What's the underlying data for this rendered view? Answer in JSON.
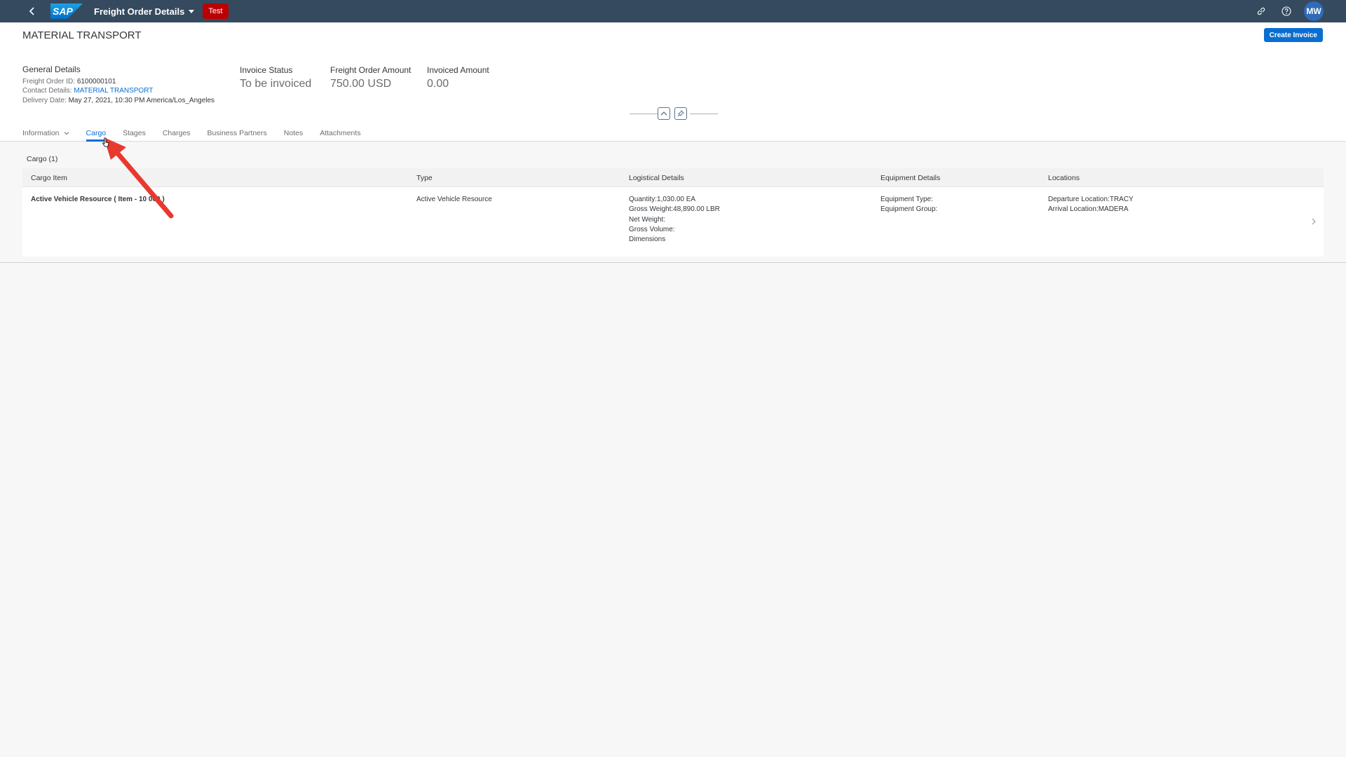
{
  "shell": {
    "logo": "SAP",
    "app_title": "Freight Order Details",
    "env_badge": "Test",
    "avatar_initials": "MW",
    "icons": [
      "back-icon",
      "link-icon",
      "help-icon"
    ]
  },
  "header": {
    "title": "MATERIAL TRANSPORT",
    "create_invoice_label": "Create Invoice",
    "general_details": {
      "title": "General Details",
      "freight_order_id_label": "Freight Order ID:",
      "freight_order_id_value": "6100000101",
      "contact_details_label": "Contact Details:",
      "contact_details_value": "MATERIAL TRANSPORT",
      "delivery_date_label": "Delivery Date:",
      "delivery_date_value": "May 27, 2021, 10:30 PM America/Los_Angeles"
    },
    "kpis": [
      {
        "label": "Invoice Status",
        "value": "To be invoiced"
      },
      {
        "label": "Freight Order Amount",
        "value": "750.00 USD"
      },
      {
        "label": "Invoiced Amount",
        "value": "0.00"
      }
    ]
  },
  "tabs": [
    {
      "label": "Information",
      "has_dropdown": true,
      "active": false
    },
    {
      "label": "Cargo",
      "active": true
    },
    {
      "label": "Stages",
      "active": false
    },
    {
      "label": "Charges",
      "active": false
    },
    {
      "label": "Business Partners",
      "active": false
    },
    {
      "label": "Notes",
      "active": false
    },
    {
      "label": "Attachments",
      "active": false
    }
  ],
  "cargo": {
    "section_title": "Cargo (1)",
    "columns": [
      "Cargo Item",
      "Type",
      "Logistical Details",
      "Equipment Details",
      "Locations"
    ],
    "rows": [
      {
        "cargo_item": "Active Vehicle Resource ( Item - 10 000 )",
        "type": "Active Vehicle Resource",
        "logistical": [
          "Quantity:1,030.00 EA",
          "Gross Weight:48,890.00 LBR",
          "Net Weight:",
          "Gross Volume:",
          "Dimensions"
        ],
        "equipment": [
          "Equipment Type:",
          "Equipment Group:"
        ],
        "locations": [
          "Departure Location:TRACY",
          "Arrival Location:MADERA"
        ]
      }
    ]
  },
  "colors": {
    "shell_bg": "#354a5f",
    "accent": "#0a6ed1",
    "badge": "#bb0000",
    "annotation_arrow": "#e8392f"
  }
}
